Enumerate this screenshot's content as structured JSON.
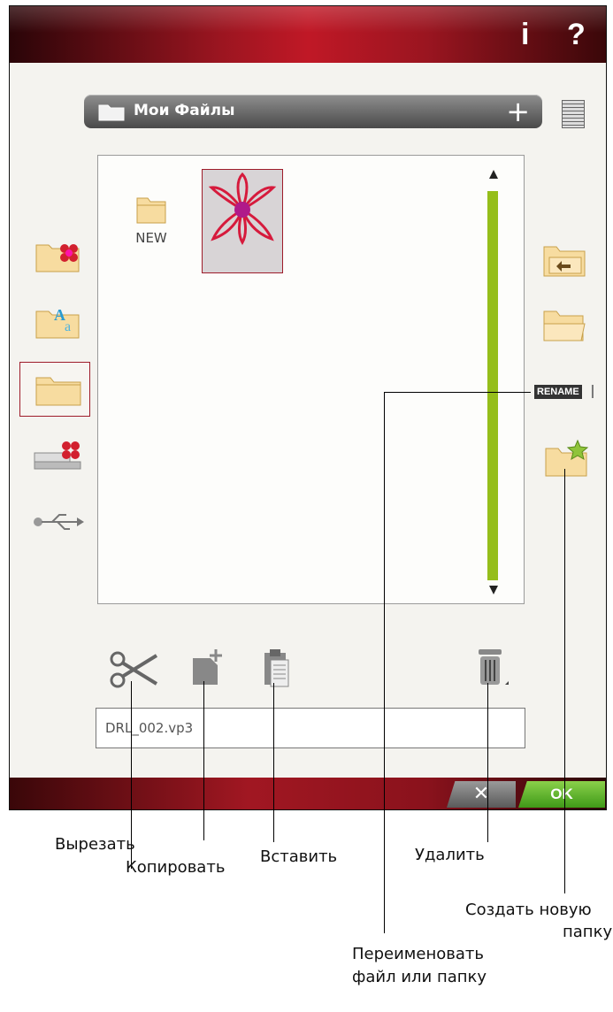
{
  "header": {
    "info": "i",
    "help": "?"
  },
  "folder": {
    "title": "Мои Файлы",
    "add_label": "+"
  },
  "files": {
    "new_folder_label": "NEW"
  },
  "rename_label": "RENAME",
  "filename_value": "DRL_002.vp3",
  "footer": {
    "cancel_label": "✕",
    "ok_label": "OK"
  },
  "callouts": {
    "cut": "Вырезать",
    "copy": "Копировать",
    "paste": "Вставить",
    "delete": "Удалить",
    "new_folder_line1": "Создать новую",
    "new_folder_line2": "папку",
    "rename_line1": "Переименовать",
    "rename_line2": "файл или папку"
  },
  "colors": {
    "accent_red": "#9e1c2a",
    "scroll_green": "#95be1b",
    "ok_green": "#4caf23"
  },
  "icons": [
    "folder-icon",
    "designs-folder-icon",
    "fonts-folder-icon",
    "my-files-folder-icon",
    "machine-folder-icon",
    "usb-icon",
    "folder-up-icon",
    "open-folder-icon",
    "new-folder-star-icon",
    "scissors-icon",
    "copy-icon",
    "paste-icon",
    "trash-icon",
    "list-view-icon"
  ]
}
